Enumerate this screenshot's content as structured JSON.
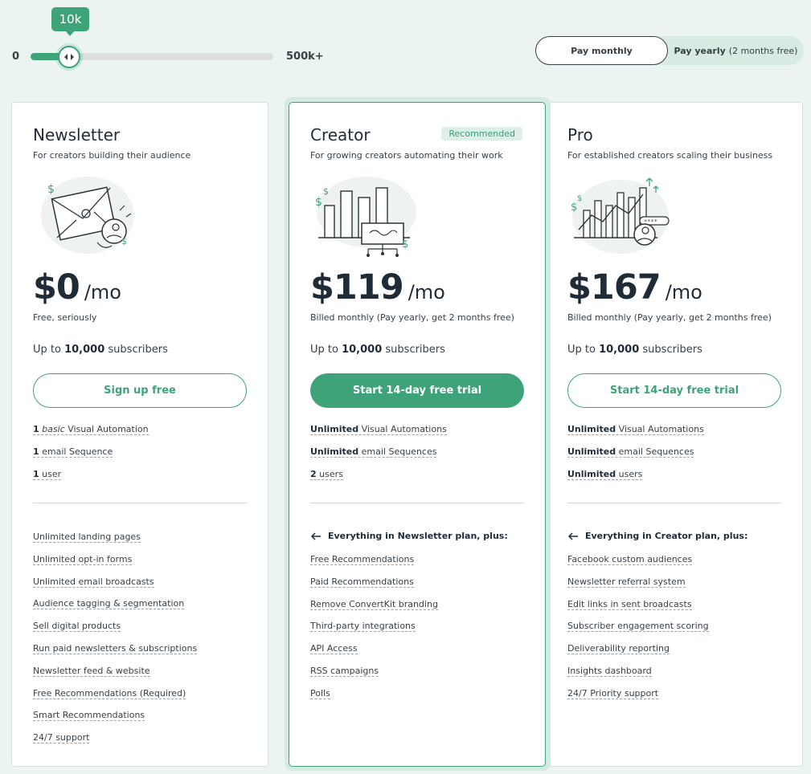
{
  "slider": {
    "min_label": "0",
    "max_label": "500k+",
    "tooltip": "10k",
    "value_fraction": 0.16
  },
  "billing": {
    "monthly_label": "Pay monthly",
    "yearly_label": "Pay yearly",
    "yearly_note": "(2 months free)",
    "selected": "monthly"
  },
  "colors": {
    "accent": "#3fa37a",
    "background": "#ebf4f0",
    "text": "#373f45"
  },
  "plans": [
    {
      "name": "Newsletter",
      "tagline": "For creators building their audience",
      "illustration": "envelope-illustration",
      "price": "$0",
      "per": "/mo",
      "billing_note": "Free, seriously",
      "subs_prefix": "Up to",
      "subs_count": "10,000",
      "subs_suffix": "subscribers",
      "cta": "Sign up free",
      "key_features": [
        {
          "strong": "1",
          "em": "basic",
          "rest": "Visual Automation"
        },
        {
          "strong": "1",
          "em": "",
          "rest": "email Sequence"
        },
        {
          "strong": "1",
          "em": "",
          "rest": "user"
        }
      ],
      "features": [
        "Unlimited landing pages",
        "Unlimited opt-in forms",
        "Unlimited email broadcasts",
        "Audience tagging & segmentation",
        "Sell digital products",
        "Run paid newsletters & subscriptions",
        "Newsletter feed & website",
        "Free Recommendations (Required)",
        "Smart Recommendations",
        "24/7 support"
      ]
    },
    {
      "name": "Creator",
      "badge": "Recommended",
      "tagline": "For growing creators automating their work",
      "illustration": "bar-chart-illustration",
      "price": "$119",
      "per": "/mo",
      "billing_note": "Billed monthly (Pay yearly, get 2 months free)",
      "subs_prefix": "Up to",
      "subs_count": "10,000",
      "subs_suffix": "subscribers",
      "cta": "Start 14-day free trial",
      "key_features": [
        {
          "strong": "Unlimited",
          "em": "",
          "rest": "Visual Automations"
        },
        {
          "strong": "Unlimited",
          "em": "",
          "rest": "email Sequences"
        },
        {
          "strong": "2",
          "em": "",
          "rest": "users"
        }
      ],
      "plus_head": "Everything in Newsletter plan, plus:",
      "features": [
        "Free Recommendations",
        "Paid Recommendations",
        "Remove ConvertKit branding",
        "Third-party integrations",
        "API Access",
        "RSS campaigns",
        "Polls"
      ]
    },
    {
      "name": "Pro",
      "tagline": "For established creators scaling their business",
      "illustration": "growth-chart-illustration",
      "price": "$167",
      "per": "/mo",
      "billing_note": "Billed monthly (Pay yearly, get 2 months free)",
      "subs_prefix": "Up to",
      "subs_count": "10,000",
      "subs_suffix": "subscribers",
      "cta": "Start 14-day free trial",
      "key_features": [
        {
          "strong": "Unlimited",
          "em": "",
          "rest": "Visual Automations"
        },
        {
          "strong": "Unlimited",
          "em": "",
          "rest": "email Sequences"
        },
        {
          "strong": "Unlimited",
          "em": "",
          "rest": "users"
        }
      ],
      "plus_head": "Everything in Creator plan, plus:",
      "features": [
        "Facebook custom audiences",
        "Newsletter referral system",
        "Edit links in sent broadcasts",
        "Subscriber engagement scoring",
        "Deliverability reporting",
        "Insights dashboard",
        "24/7 Priority support"
      ]
    }
  ]
}
